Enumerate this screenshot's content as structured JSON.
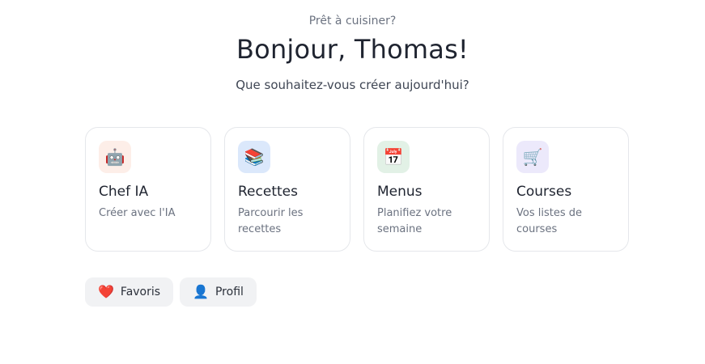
{
  "hero": {
    "eyebrow": "Prêt à cuisiner?",
    "greeting": "Bonjour, Thomas!",
    "prompt": "Que souhaitez-vous créer aujourd'hui?"
  },
  "cards": [
    {
      "title": "Chef IA",
      "description": "Créer avec l'IA",
      "icon": "robot-icon",
      "emoji": "🤖",
      "icon_bg": "#fdeee8"
    },
    {
      "title": "Recettes",
      "description": "Parcourir les recettes",
      "icon": "books-icon",
      "emoji": "📚",
      "icon_bg": "#dbe8fb"
    },
    {
      "title": "Menus",
      "description": "Planifiez votre semaine",
      "icon": "calendar-icon",
      "emoji": "📅",
      "icon_bg": "#e2f1e6"
    },
    {
      "title": "Courses",
      "description": "Vos listes de courses",
      "icon": "shopping-cart-icon",
      "emoji": "🛒",
      "icon_bg": "#ece9fb"
    }
  ],
  "quick_links": [
    {
      "label": "Favoris",
      "icon": "heart-icon",
      "emoji": "❤️"
    },
    {
      "label": "Profil",
      "icon": "person-icon",
      "emoji": "👤"
    }
  ]
}
